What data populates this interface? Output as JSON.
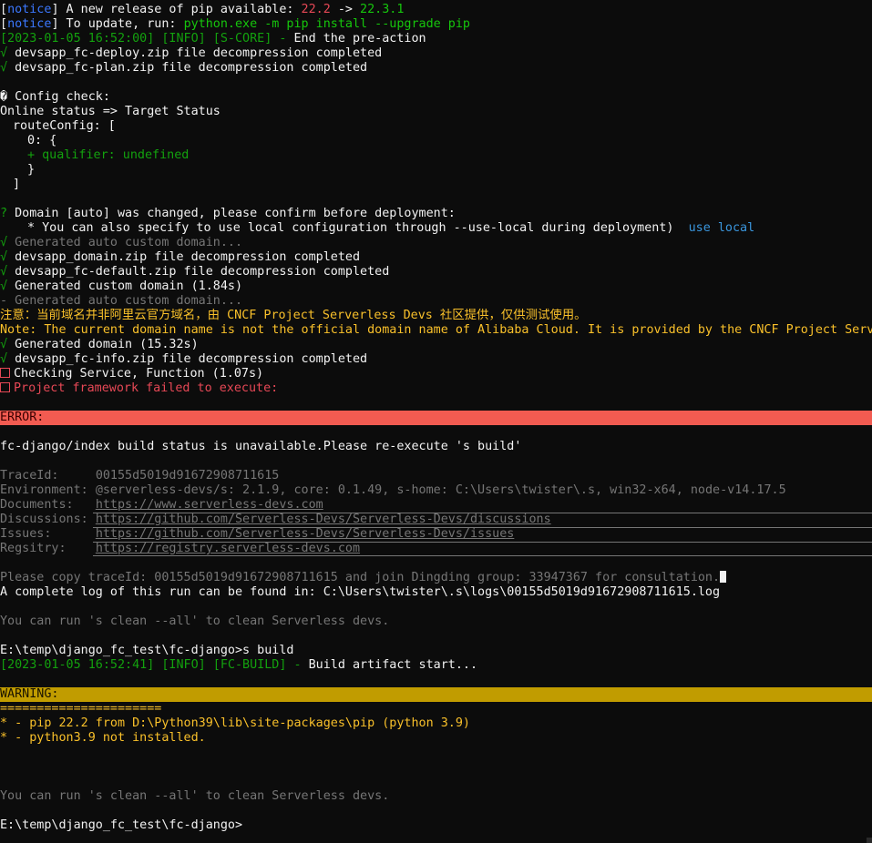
{
  "pip_notice": {
    "tag": "notice",
    "line1_text": " A new release of pip available: ",
    "old_version": "22.2",
    "arrow": " -> ",
    "new_version": "22.3.1",
    "line2_text": " To update, run: ",
    "update_command": "python.exe -m pip install --upgrade pip"
  },
  "log1": {
    "prefix": "[2023-01-05 16:52:00] [INFO] [S-CORE] - ",
    "text": "End the pre-action"
  },
  "check_mark": "√",
  "deploy_zip": " devsapp_fc-deploy.zip file decompression completed",
  "plan_zip": " devsapp_fc-plan.zip file decompression completed",
  "config_check": "� Config check:",
  "status_header": "Online status => Target Status",
  "route_config": "routeConfig: [",
  "idx0": "0: {",
  "qualifier": "+ qualifier: undefined",
  "close_brace": "}",
  "close_bracket": "]",
  "domain_prompt": {
    "mark": "?",
    "text": " Domain [auto] was changed, please confirm before deployment:",
    "hint": "* You can also specify to use local configuration through --use-local during deployment)  ",
    "choice": "use local"
  },
  "gen_auto": " Generated auto custom domain...",
  "domain_zip": " devsapp_domain.zip file decompression completed",
  "default_zip": " devsapp_fc-default.zip file decompression completed",
  "gen_custom": " Generated custom domain (1.84s)",
  "gen_auto2": "- Generated auto custom domain...",
  "note_cn": "注意：当前域名并非阿里云官方域名，由 CNCF Project Serverless Devs 社区提供，仅供测试使用。",
  "note_en": "Note: The current domain name is not the official domain name of Alibaba Cloud. It is provided by the CNCF Project Serverless Devs community",
  "gen_domain": " Generated domain (15.32s)",
  "info_zip": " devsapp_fc-info.zip file decompression completed",
  "checking_service": "Checking Service, Function (1.07s)",
  "framework_failed": "Project framework failed to execute:",
  "error_label": "ERROR:",
  "build_unavailable": "fc-django/index build status is unavailable.Please re-execute 's build'",
  "details": {
    "traceid_label": "TraceId:     ",
    "traceid_value": "00155d5019d91672908711615",
    "environment_label": "Environment: ",
    "environment_value": "@serverless-devs/s: 2.1.9, core: 0.1.49, s-home: C:\\Users\\twister\\.s, win32-x64, node-v14.17.5",
    "documents_label": "Documents:   ",
    "documents_value": "https://www.serverless-devs.com",
    "discussions_label": "Discussions: ",
    "discussions_value": "https://github.com/Serverless-Devs/Serverless-Devs/discussions",
    "issues_label": "Issues:      ",
    "issues_value": "https://github.com/Serverless-Devs/Serverless-Devs/issues",
    "registry_label": "Regsitry:    ",
    "registry_value": "https://registry.serverless-devs.com"
  },
  "copy_traceid": "Please copy traceId: 00155d5019d91672908711615 and join Dingding group: 33947367 for consultation.",
  "log_path": "A complete log of this run can be found in: C:\\Users\\twister\\.s\\logs\\00155d5019d91672908711615.log",
  "clean_hint": "You can run 's clean --all' to clean Serverless devs.",
  "prompt1": "E:\\temp\\django_fc_test\\fc-django>s build",
  "log2": {
    "prefix": "[2023-01-05 16:52:41] [INFO] [FC-BUILD] - ",
    "text": "Build artifact start..."
  },
  "warning_label": "WARNING:",
  "warning_rule": "======================",
  "warn_pip": "* - pip 22.2 from D:\\Python39\\lib\\site-packages\\pip (python 3.9)",
  "warn_python": "* - python3.9 not installed.",
  "clean_hint2": "You can run 's clean --all' to clean Serverless devs.",
  "prompt2": "E:\\temp\\django_fc_test\\fc-django>"
}
